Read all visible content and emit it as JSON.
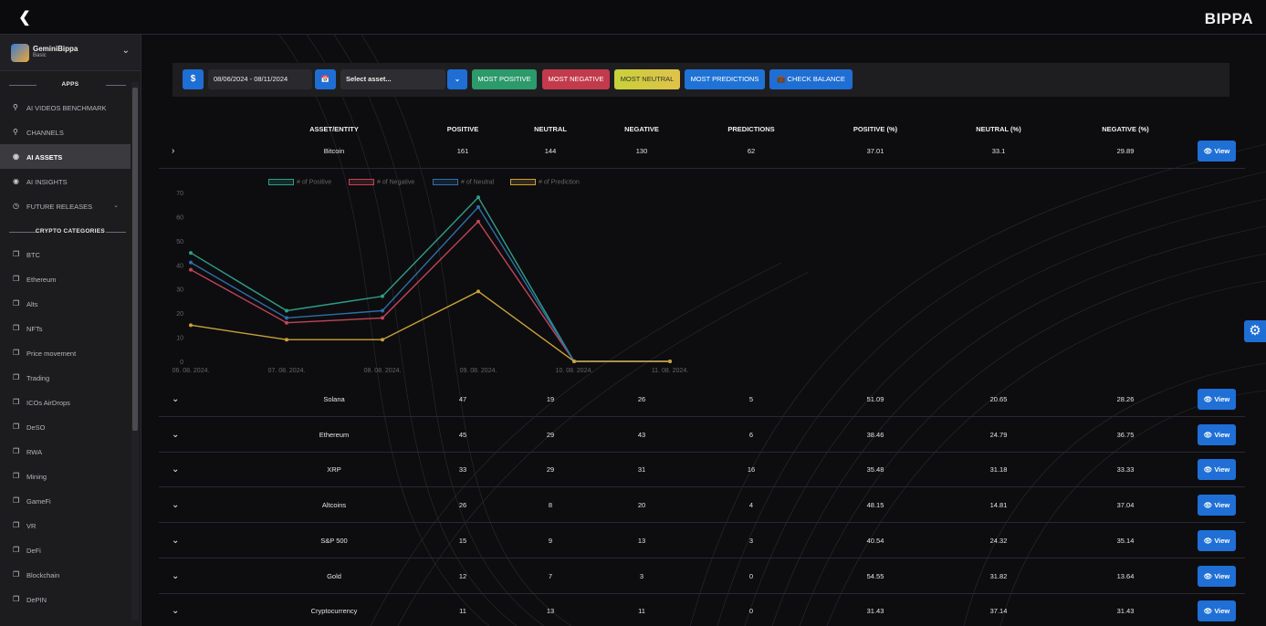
{
  "header": {
    "back_icon": "chevron-left-icon",
    "brand": "BIPPA"
  },
  "user": {
    "name": "GeminiBippa",
    "plan": "Basic"
  },
  "sidebar": {
    "apps_label": "APPS",
    "apps": [
      {
        "label": "AI VIDEOS BENCHMARK",
        "icon": "search-icon"
      },
      {
        "label": "CHANNELS",
        "icon": "search-icon"
      },
      {
        "label": "AI ASSETS",
        "icon": "eye-icon",
        "active": true
      },
      {
        "label": "AI INSIGHTS",
        "icon": "eye-icon"
      },
      {
        "label": "FUTURE RELEASES",
        "icon": "clock-icon"
      }
    ],
    "crypto_label": "CRYPTO CATEGORIES",
    "categories": [
      "BTC",
      "Ethereum",
      "Alts",
      "NFTs",
      "Price movement",
      "Trading",
      "ICOs AirDrops",
      "DeSO",
      "RWA",
      "Mining",
      "GameFi",
      "VR",
      "DeFi",
      "Blockchain",
      "DePIN"
    ]
  },
  "toolbar": {
    "currency": "$",
    "date_range": "08/06/2024 - 08/11/2024",
    "asset_placeholder": "Select asset...",
    "most_positive": "MOST POSITIVE",
    "most_negative": "MOST NEGATIVE",
    "most_neutral": "MOST NEUTRAL",
    "most_predictions": "MOST PREDICTIONS",
    "check_balance": "CHECK BALANCE"
  },
  "table": {
    "columns": [
      "ASSET/ENTITY",
      "POSITIVE",
      "NEUTRAL",
      "NEGATIVE",
      "PREDICTIONS",
      "POSITIVE (%)",
      "NEUTRAL (%)",
      "NEGATIVE (%)"
    ],
    "view_label": "View",
    "rows": [
      [
        "Bitcoin",
        "161",
        "144",
        "130",
        "62",
        "37.01",
        "33.1",
        "29.89"
      ],
      [
        "Solana",
        "47",
        "19",
        "26",
        "5",
        "51.09",
        "20.65",
        "28.26"
      ],
      [
        "Ethereum",
        "45",
        "29",
        "43",
        "6",
        "38.46",
        "24.79",
        "36.75"
      ],
      [
        "XRP",
        "33",
        "29",
        "31",
        "16",
        "35.48",
        "31.18",
        "33.33"
      ],
      [
        "Altcoins",
        "26",
        "8",
        "20",
        "4",
        "48.15",
        "14.81",
        "37.04"
      ],
      [
        "S&P 500",
        "15",
        "9",
        "13",
        "3",
        "40.54",
        "24.32",
        "35.14"
      ],
      [
        "Gold",
        "12",
        "7",
        "3",
        "0",
        "54.55",
        "31.82",
        "13.64"
      ],
      [
        "Cryptocurrency",
        "11",
        "13",
        "11",
        "0",
        "31.43",
        "37.14",
        "31.43"
      ]
    ]
  },
  "chart_data": {
    "type": "line",
    "x": [
      "06. 08. 2024.",
      "07. 08. 2024.",
      "08. 08. 2024.",
      "09. 08. 2024.",
      "10. 08. 2024.",
      "11. 08. 2024."
    ],
    "ylim": [
      0,
      70
    ],
    "yticks": [
      "0",
      "10",
      "20",
      "30",
      "40",
      "50",
      "60",
      "70"
    ],
    "series": [
      {
        "name": "# of Positive",
        "color": "#2f9e8a",
        "values": [
          45,
          21,
          27,
          68,
          0,
          0
        ]
      },
      {
        "name": "# of Negative",
        "color": "#c2455a",
        "values": [
          38,
          16,
          18,
          58,
          0,
          0
        ]
      },
      {
        "name": "# of Neutral",
        "color": "#2f6fa8",
        "values": [
          41,
          18,
          21,
          64,
          0,
          0
        ]
      },
      {
        "name": "# of Prediction",
        "color": "#c9a23a",
        "values": [
          15,
          9,
          9,
          29,
          0,
          0
        ]
      }
    ]
  }
}
